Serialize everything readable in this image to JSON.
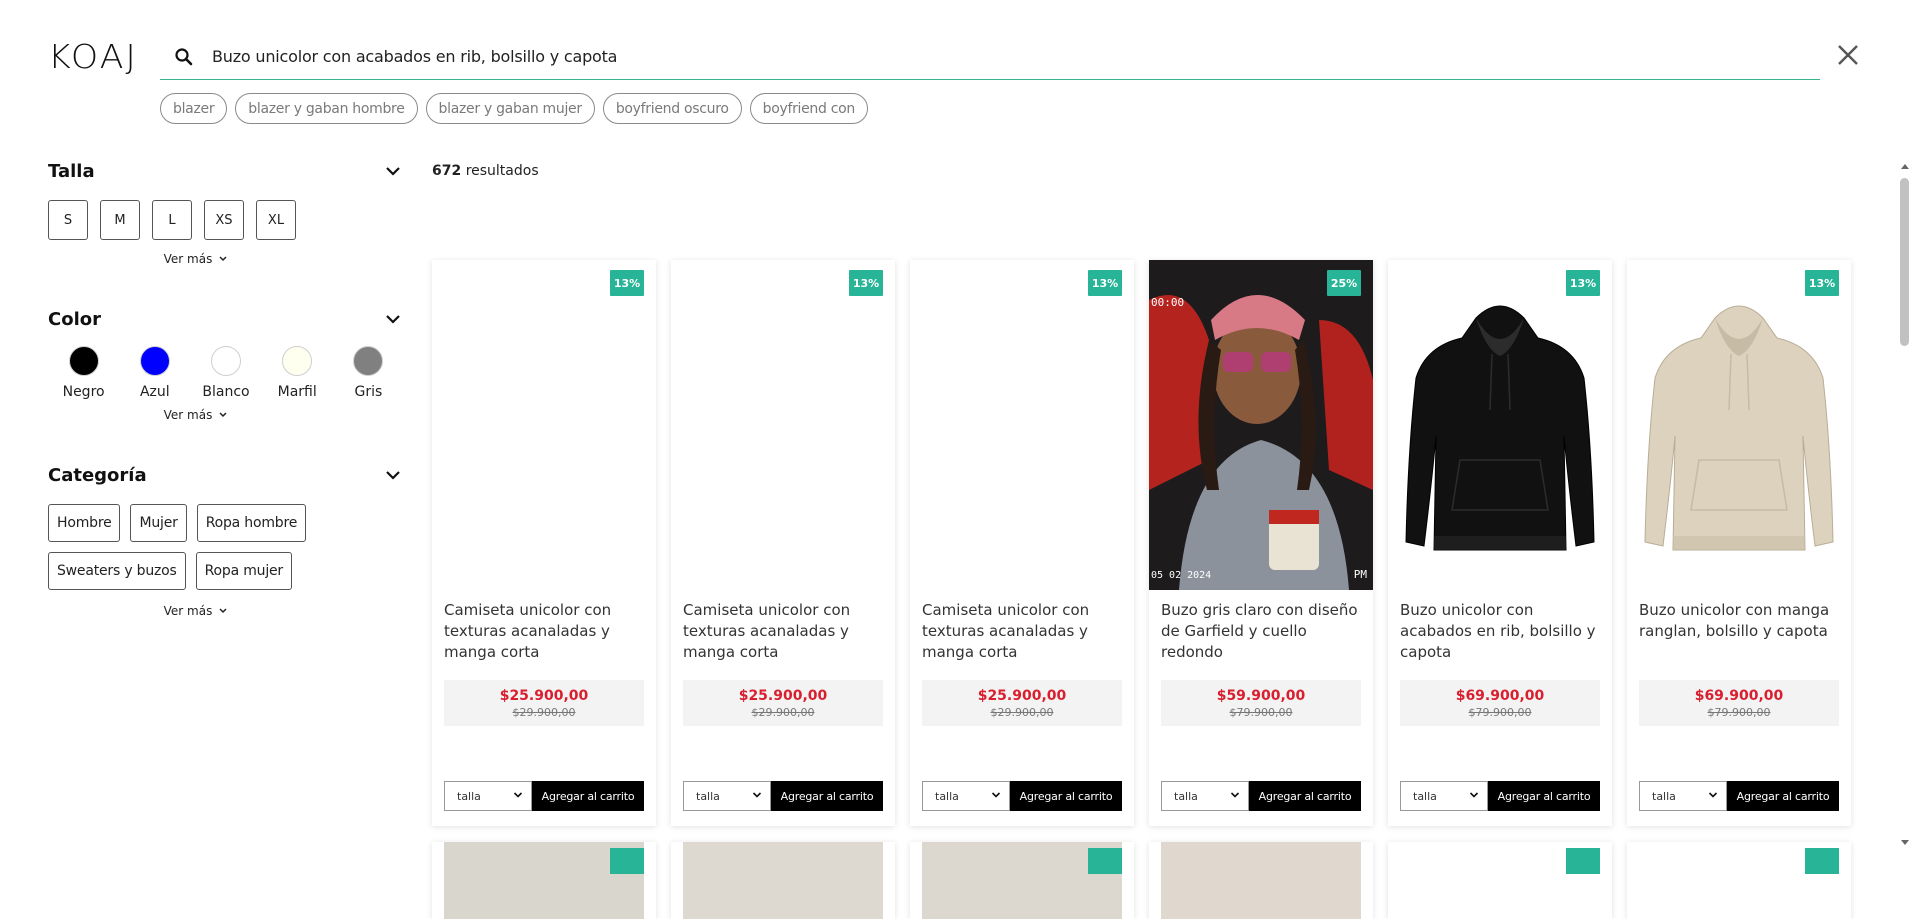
{
  "brand": {
    "logo_text": "KOAJ"
  },
  "search": {
    "value": "Buzo unicolor con acabados en rib, bolsillo y capota",
    "accent_color": "#39b28f"
  },
  "suggestions": [
    "blazer",
    "blazer y gaban hombre",
    "blazer y gaban mujer",
    "boyfriend oscuro",
    "boyfriend con"
  ],
  "filters": {
    "talla": {
      "title": "Talla",
      "sizes": [
        "S",
        "M",
        "L",
        "XS",
        "XL"
      ],
      "more": "Ver más"
    },
    "color": {
      "title": "Color",
      "items": [
        {
          "name": "Negro",
          "hex": "#000000"
        },
        {
          "name": "Azul",
          "hex": "#0000ff"
        },
        {
          "name": "Blanco",
          "hex": "#ffffff"
        },
        {
          "name": "Marfil",
          "hex": "#fffff0"
        },
        {
          "name": "Gris",
          "hex": "#808080"
        }
      ],
      "more": "Ver más"
    },
    "categoria": {
      "title": "Categoría",
      "items": [
        "Hombre",
        "Mujer",
        "Ropa hombre",
        "Sweaters y buzos",
        "Ropa mujer"
      ],
      "more": "Ver más"
    }
  },
  "results": {
    "count": "672",
    "label": "resultados"
  },
  "products": [
    {
      "name": "Camiseta unicolor con texturas acanaladas y manga corta",
      "discount": "13%",
      "price": "$25.900,00",
      "old_price": "$29.900,00",
      "image": "blank",
      "size_placeholder": "talla",
      "cart_label": "Agregar al carrito"
    },
    {
      "name": "Camiseta unicolor con texturas acanaladas y manga corta",
      "discount": "13%",
      "price": "$25.900,00",
      "old_price": "$29.900,00",
      "image": "blank",
      "size_placeholder": "talla",
      "cart_label": "Agregar al carrito"
    },
    {
      "name": "Camiseta unicolor con texturas acanaladas y manga corta",
      "discount": "13%",
      "price": "$25.900,00",
      "old_price": "$29.900,00",
      "image": "blank",
      "size_placeholder": "talla",
      "cart_label": "Agregar al carrito"
    },
    {
      "name": "Buzo gris claro con diseño de Garfield y cuello redondo",
      "discount": "25%",
      "price": "$59.900,00",
      "old_price": "$79.900,00",
      "image": "photo-model",
      "size_placeholder": "talla",
      "cart_label": "Agregar al carrito",
      "photo_overlay": {
        "top_left": "00:00",
        "bottom_left": "05 02 2024",
        "bottom_right": "PM"
      }
    },
    {
      "name": "Buzo unicolor con acabados en rib, bolsillo y capota",
      "discount": "13%",
      "price": "$69.900,00",
      "old_price": "$79.900,00",
      "image": "hoodie-black",
      "size_placeholder": "talla",
      "cart_label": "Agregar al carrito"
    },
    {
      "name": "Buzo unicolor con manga ranglan, bolsillo y capota",
      "discount": "13%",
      "price": "$69.900,00",
      "old_price": "$79.900,00",
      "image": "hoodie-beige",
      "size_placeholder": "talla",
      "cart_label": "Agregar al carrito"
    }
  ],
  "next_row": [
    {
      "image_color": "#d9d6ce",
      "has_badge": true
    },
    {
      "image_color": "#ddd8d0",
      "has_badge": false
    },
    {
      "image_color": "#dcd8d0",
      "has_badge": true
    },
    {
      "image_color": "#e0d7cf",
      "has_badge": false
    },
    {
      "image_color": "#ffffff",
      "has_badge": true
    },
    {
      "image_color": "#ffffff",
      "has_badge": true
    }
  ],
  "colors": {
    "badge": "#28b496",
    "price": "#d91e2e",
    "cart_button": "#000000"
  }
}
